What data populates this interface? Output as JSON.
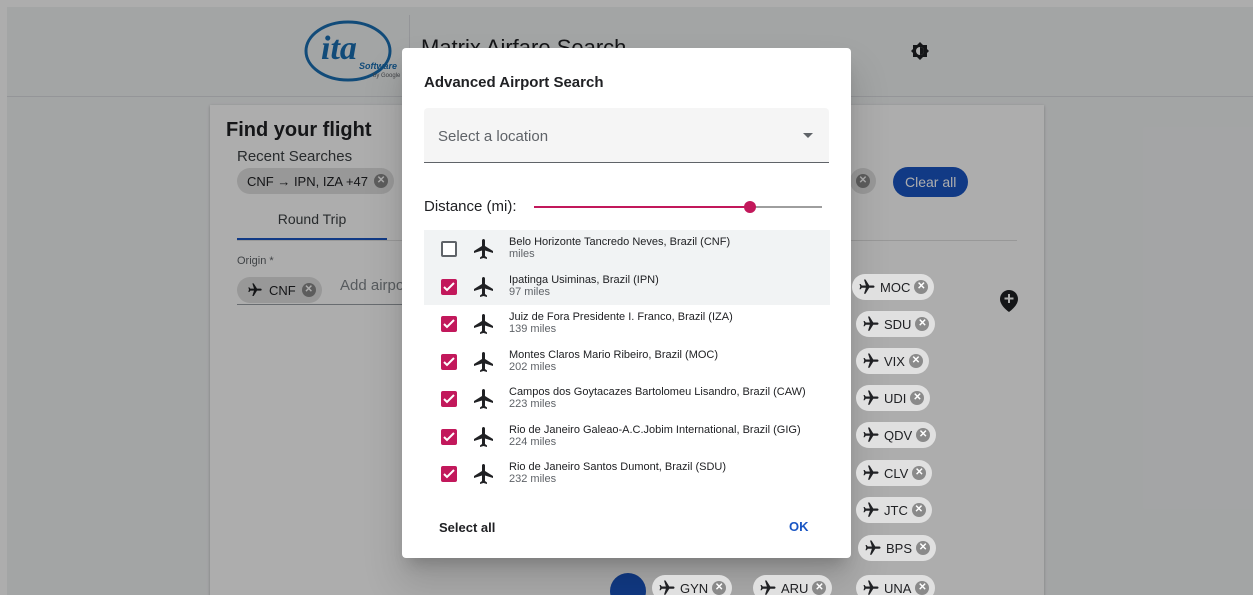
{
  "app": {
    "title": "Matrix Airfare Search",
    "logo_text": "ita",
    "logo_sub": "Software",
    "logo_by": "by Google"
  },
  "card": {
    "title": "Find your flight",
    "recent_label": "Recent Searches",
    "recent_chip": "CNF → IPN, IZA +47",
    "clear_all": "Clear all",
    "tab_round_trip": "Round Trip",
    "origin_label": "Origin *",
    "origin_chip": "CNF",
    "add_airport_placeholder": "Add airpo"
  },
  "dest_chips": [
    "MOC",
    "SDU",
    "VIX",
    "UDI",
    "QDV",
    "CLV",
    "JTC",
    "BPS"
  ],
  "bottom_chips": [
    "GYN",
    "ARU",
    "UNA"
  ],
  "dialog": {
    "title": "Advanced Airport Search",
    "select_placeholder": "Select a location",
    "distance_label": "Distance (mi):",
    "distance_value_fraction": 0.75,
    "select_all": "Select all",
    "ok": "OK",
    "airports": [
      {
        "name": "Belo Horizonte Tancredo Neves, Brazil (CNF)",
        "distance": "miles",
        "checked": false
      },
      {
        "name": "Ipatinga Usiminas, Brazil (IPN)",
        "distance": "97 miles",
        "checked": true
      },
      {
        "name": "Juiz de Fora Presidente I. Franco, Brazil (IZA)",
        "distance": "139 miles",
        "checked": true
      },
      {
        "name": "Montes Claros Mario Ribeiro, Brazil (MOC)",
        "distance": "202 miles",
        "checked": true
      },
      {
        "name": "Campos dos Goytacazes Bartolomeu Lisandro, Brazil (CAW)",
        "distance": "223 miles",
        "checked": true
      },
      {
        "name": "Rio de Janeiro Galeao-A.C.Jobim International, Brazil (GIG)",
        "distance": "224 miles",
        "checked": true
      },
      {
        "name": "Rio de Janeiro Santos Dumont, Brazil (SDU)",
        "distance": "232 miles",
        "checked": true
      }
    ]
  },
  "colors": {
    "accent": "#c2185b",
    "primary": "#1a56c4"
  }
}
